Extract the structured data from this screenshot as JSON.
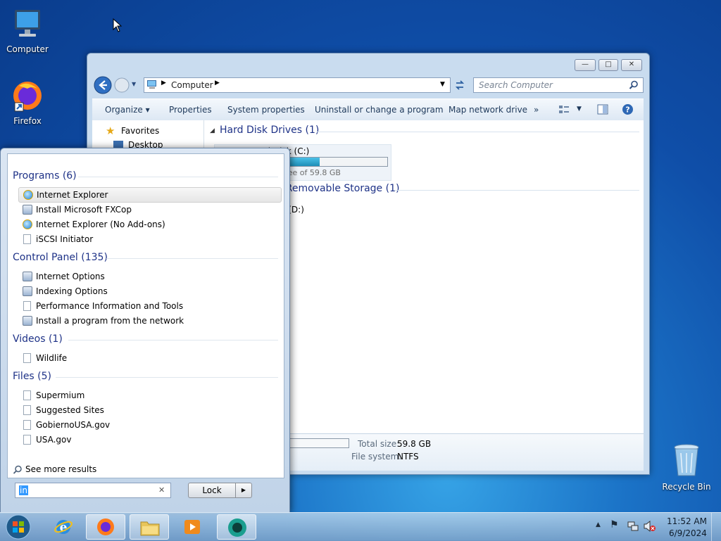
{
  "desktop": {
    "icons": [
      {
        "label": "Computer"
      },
      {
        "label": "Firefox"
      },
      {
        "label": "Recycle Bin"
      }
    ]
  },
  "explorer": {
    "address": "Computer",
    "search_placeholder": "Search Computer",
    "commands": [
      "Organize",
      "Properties",
      "System properties",
      "Uninstall or change a program",
      "Map network drive",
      "»"
    ],
    "nav": [
      "Favorites",
      "Desktop"
    ],
    "hard_disk_group": "Hard Disk Drives (1)",
    "drive_c": "Local Disk (C:)",
    "drive_c_free": "29.1 GB free of 59.8 GB",
    "drive_c_used_fraction": 0.51,
    "removable_group": "Devices with Removable Storage (1)",
    "drive_d": "CD Drive (D:)",
    "details": {
      "total_size_label": "Total size:",
      "total_size_value": "59.8 GB",
      "fs_label": "File system:",
      "fs_value": "NTFS",
      "used_fraction": 0.51
    }
  },
  "start_menu": {
    "categories": [
      {
        "title": "Programs (6)",
        "items": [
          "Internet Explorer",
          "Install Microsoft FXCop",
          "Internet Explorer (No Add-ons)",
          "iSCSI Initiator"
        ]
      },
      {
        "title": "Control Panel (135)",
        "items": [
          "Internet Options",
          "Indexing Options",
          "Performance Information and Tools",
          "Install a program from the network"
        ]
      },
      {
        "title": "Videos (1)",
        "items": [
          "Wildlife"
        ]
      },
      {
        "title": "Files (5)",
        "items": [
          "Supermium",
          "Suggested Sites",
          "GobiernoUSA.gov",
          "USA.gov"
        ]
      }
    ],
    "see_more": "See more results",
    "search_value": "in",
    "lock_label": "Lock"
  },
  "taskbar": {
    "time": "11:52 AM",
    "date": "6/9/2024"
  }
}
